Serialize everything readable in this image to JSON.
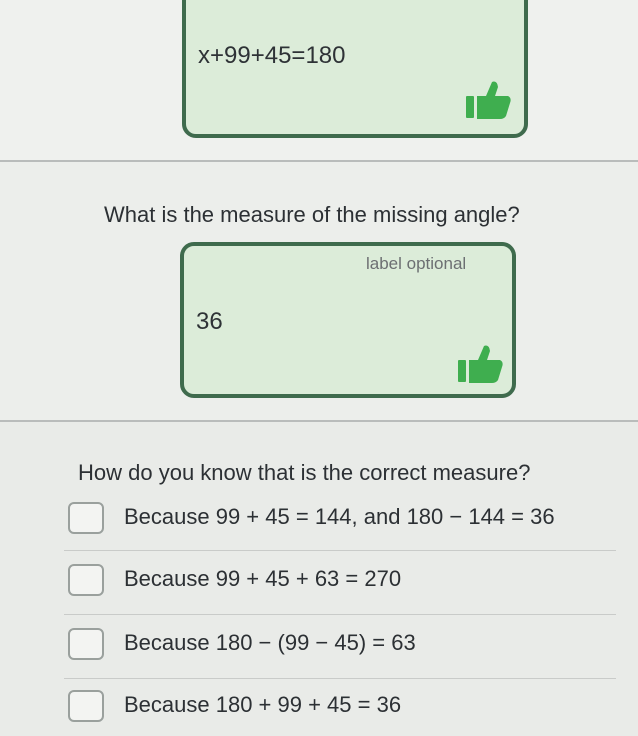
{
  "answer_box_1": {
    "text": "x+99+45=180",
    "icon": "thumbs-up-icon"
  },
  "question_1": {
    "text": "What is the measure of the missing angle?"
  },
  "answer_box_2": {
    "label": "label optional",
    "text": "36",
    "icon": "thumbs-up-icon"
  },
  "question_2": {
    "text": "How do you know that is the correct measure?"
  },
  "choices": [
    {
      "label": "Because 99 + 45 = 144, and 180 − 144 = 36"
    },
    {
      "label": "Because 99 + 45 + 63 = 270"
    },
    {
      "label": "Because 180 − (99 − 45) = 63"
    },
    {
      "label": "Because 180 + 99 + 45 = 36"
    }
  ],
  "colors": {
    "box_border": "#3f6b4d",
    "box_fill": "#dcecd9",
    "thumb": "#3fae4f"
  }
}
